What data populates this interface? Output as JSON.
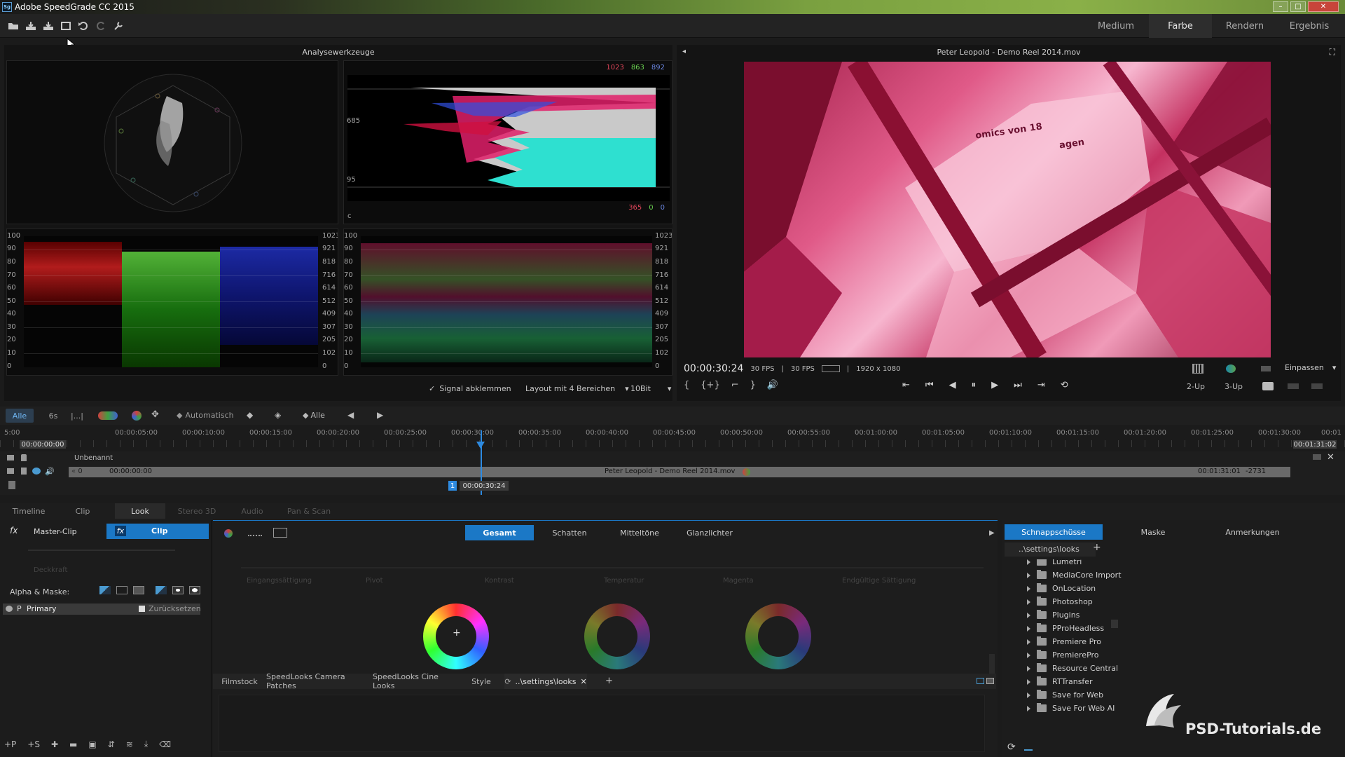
{
  "window": {
    "title": "Adobe SpeedGrade CC 2015",
    "app_badge": "Sg",
    "minimize": "–",
    "maximize": "□",
    "close": "✕"
  },
  "toolbar": {
    "mode_tabs": [
      {
        "label": "Medium"
      },
      {
        "label": "Farbe"
      },
      {
        "label": "Rendern"
      },
      {
        "label": "Ergebnis"
      }
    ],
    "active_mode": "Farbe"
  },
  "scopes": {
    "header": "Analysewerkzeuge",
    "hist_top_values": [
      "1023",
      "863",
      "892"
    ],
    "hist_bottom_values": [
      "365",
      "0",
      "0"
    ],
    "hist_marks": [
      "685",
      "95"
    ],
    "hist_corner": "c",
    "left_axis": [
      "100",
      "90",
      "80",
      "70",
      "60",
      "50",
      "40",
      "30",
      "20",
      "10",
      "0"
    ],
    "right_axis": [
      "1023",
      "921",
      "818",
      "716",
      "614",
      "512",
      "409",
      "307",
      "205",
      "102",
      "0"
    ],
    "signal_clamp": "Signal abklemmen",
    "layout_select": "Layout mit 4 Bereichen",
    "bit_select": "10Bit",
    "check": "✓",
    "dropdown": "▾"
  },
  "viewer": {
    "title": "Peter Leopold - Demo Reel 2014.mov",
    "collapse": "◂",
    "fit": "⛶",
    "frame_text": "omics von 18",
    "frame_text2": "agen",
    "timecode": "00:00:30:24",
    "fps1": "30 FPS",
    "fps2": "30 FPS",
    "sep": "|",
    "resolution": "1920 x 1080",
    "fit_label": "Einpassen",
    "view_2up": "2-Up",
    "view_3up": "3-Up",
    "transport": [
      "⇤",
      "⏮",
      "◀",
      "⏸",
      "▶",
      "⏭",
      "⇥",
      "⟲"
    ],
    "marks": [
      "{",
      "{+}",
      "⌐",
      "}",
      "🔊"
    ]
  },
  "timeline": {
    "filter_all": "Alle",
    "filter_6s": "6s",
    "filter_dots": "|...|",
    "auto_label": "Automatisch",
    "all_keys": "Alle",
    "ruler": [
      "5:00",
      "00:00:05:00",
      "00:00:10:00",
      "00:00:15:00",
      "00:00:20:00",
      "00:00:25:00",
      "00:00:30:00",
      "00:00:35:00",
      "00:00:40:00",
      "00:00:45:00",
      "00:00:50:00",
      "00:00:55:00",
      "00:01:00:00",
      "00:01:05:00",
      "00:01:10:00",
      "00:01:15:00",
      "00:01:20:00",
      "00:01:25:00",
      "00:01:30:00",
      "00:01"
    ],
    "start_time": "00:00:00:00",
    "end_time": "00:01:31:02",
    "track_name": "Unbenannt",
    "clip_index": "0",
    "clip_in": "00:00:00:00",
    "clip_name": "Peter Leopold - Demo Reel 2014.mov",
    "clip_out": "00:01:31:01",
    "clip_offset": "-2731",
    "playhead_tc": "00:00:30:24",
    "playhead_idx": "1",
    "close": "✕"
  },
  "bottom": {
    "tabs": [
      "Timeline",
      "Clip",
      "Look",
      "Stereo 3D",
      "Audio",
      "Pan & Scan"
    ],
    "active_tab": "Look",
    "fx": "fx",
    "master_clip": "Master-Clip",
    "clip": "Clip",
    "opacity": "Deckkraft",
    "alpha_mask": "Alpha & Maske:",
    "layer_p": "P",
    "layer_primary": "Primary",
    "reset": "Zurücksetzen",
    "range_tabs": [
      "Gesamt",
      "Schatten",
      "Mitteltöne",
      "Glanzlichter"
    ],
    "params": [
      "Eingangssättigung",
      "Pivot",
      "Kontrast",
      "Temperatur",
      "Magenta",
      "Endgültige Sättigung"
    ],
    "look_tabs": [
      "Filmstock",
      "SpeedLooks Camera Patches",
      "SpeedLooks Cine Looks",
      "Style",
      "..\\settings\\looks"
    ],
    "add": "+",
    "close": "✕",
    "bottom_tools": [
      "+P",
      "+S",
      "✚",
      "▬",
      "▣",
      "⇵",
      "≋",
      "⤓",
      "⌫"
    ]
  },
  "side": {
    "tabs": [
      "Schnappschüsse",
      "Maske",
      "Anmerkungen"
    ],
    "path": "..\\settings\\looks",
    "add": "+",
    "folders": [
      "Lumetri",
      "MediaCore Import",
      "OnLocation",
      "Photoshop",
      "Plugins",
      "PProHeadless",
      "Premiere Pro",
      "PremierePro",
      "Resource Central",
      "RTTransfer",
      "Save for Web",
      "Save For Web AI"
    ],
    "watermark": "PSD-Tutorials.de",
    "refresh": "⟳"
  },
  "colors": {
    "accent": "#1b78c6",
    "accent_light": "#6fb6f2",
    "bg": "#1b1b1b",
    "panel": "#141414"
  }
}
